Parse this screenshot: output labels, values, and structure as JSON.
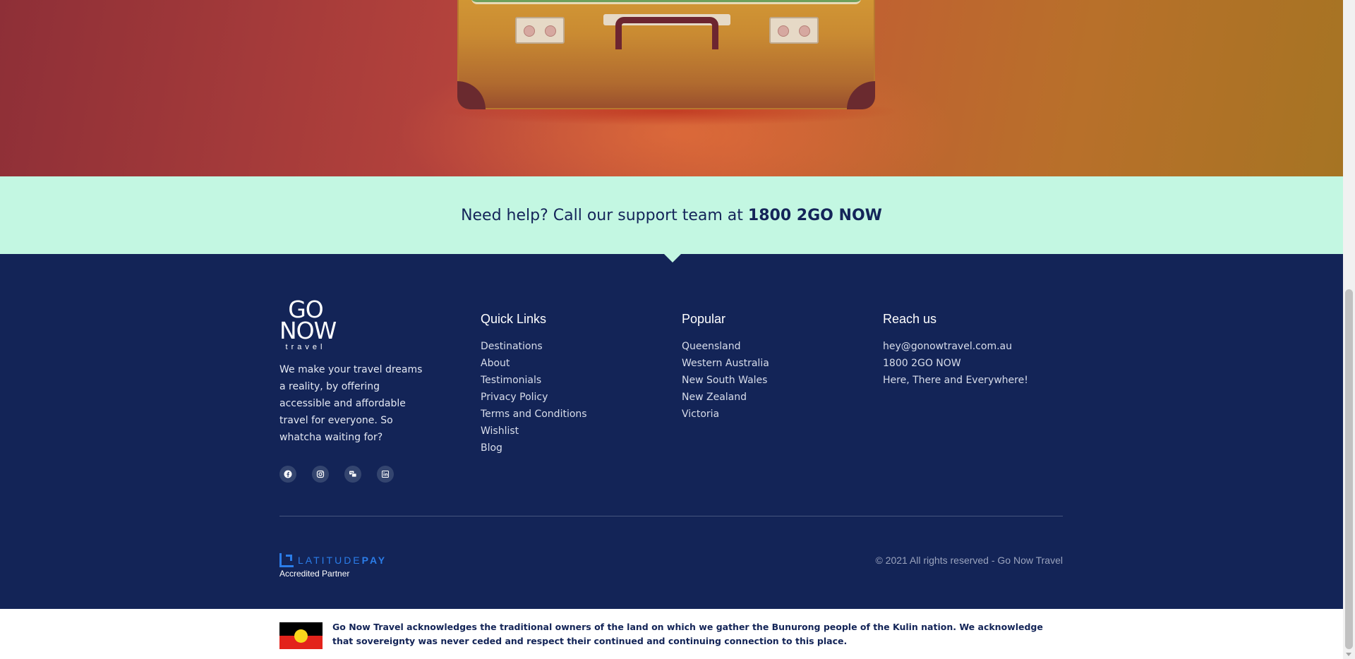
{
  "help": {
    "text": "Need help? Call our support team at",
    "phone": "1800 2GO NOW"
  },
  "brand": {
    "logo_line1": "GO",
    "logo_line2": "NOW",
    "logo_line3": "travel",
    "tagline": "We make your travel dreams a reality, by offering accessible and affordable travel for everyone. So whatcha waiting for?"
  },
  "socials": [
    {
      "icon": "facebook-icon"
    },
    {
      "icon": "instagram-icon"
    },
    {
      "icon": "messenger-icon"
    },
    {
      "icon": "linkedin-icon"
    }
  ],
  "quick_links": {
    "title": "Quick Links",
    "items": [
      "Destinations",
      "About",
      "Testimonials",
      "Privacy Policy",
      "Terms and Conditions",
      "Wishlist",
      "Blog"
    ]
  },
  "popular": {
    "title": "Popular",
    "items": [
      "Queensland",
      "Western Australia",
      "New South Wales",
      "New Zealand",
      "Victoria"
    ]
  },
  "reach": {
    "title": "Reach us",
    "items": [
      "hey@gonowtravel.com.au",
      "1800 2GO NOW",
      "Here, There and Everywhere!"
    ]
  },
  "partner": {
    "name_light": "LATITUDE",
    "name_bold": "PAY",
    "label": "Accredited Partner"
  },
  "copyright": "© 2021 All rights reserved - Go Now Travel",
  "acknowledgement": "Go Now Travel acknowledges the traditional owners of the land on which we gather the Bunurong people of the Kulin nation. We acknowledge that sovereignty was never ceded and respect their continued and continuing connection to this place.",
  "colors": {
    "footer_bg": "#132457",
    "help_bg": "#c3f7e2",
    "accent_blue": "#2b7de9"
  }
}
